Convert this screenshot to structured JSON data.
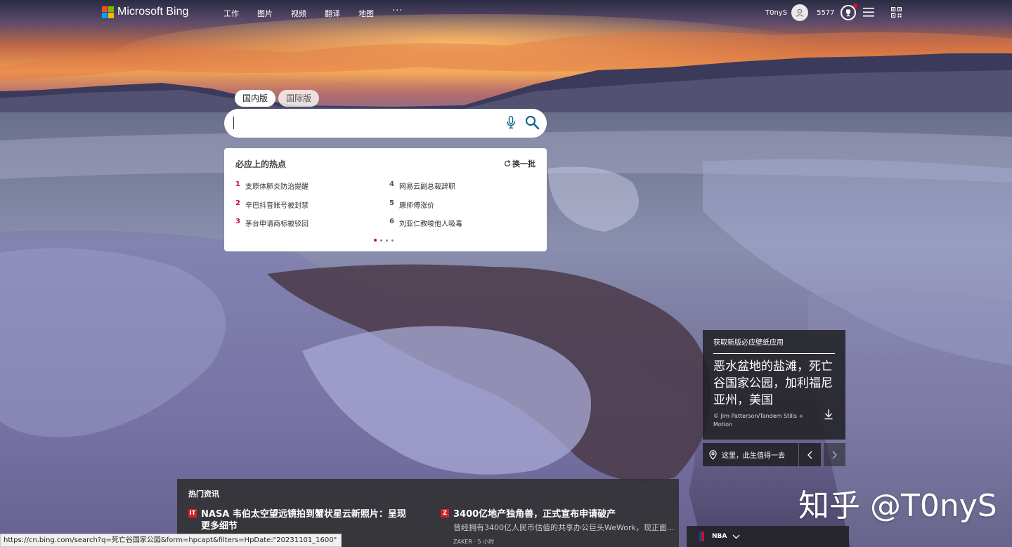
{
  "header": {
    "brand": "Microsoft Bing",
    "nav": [
      "工作",
      "图片",
      "视频",
      "翻译",
      "地图"
    ],
    "more": "···",
    "user_name": "T0nyS",
    "points": "5577"
  },
  "search": {
    "tabs": [
      {
        "label": "国内版",
        "active": true
      },
      {
        "label": "国际版",
        "active": false
      }
    ],
    "value": ""
  },
  "hot": {
    "title": "必应上的热点",
    "refresh_label": "换一批",
    "items": [
      {
        "rank": "1",
        "text": "支原体肺炎防治提醒"
      },
      {
        "rank": "2",
        "text": "辛巴抖音账号被封禁"
      },
      {
        "rank": "3",
        "text": "茅台申请商标被驳回"
      },
      {
        "rank": "4",
        "text": "网易云副总裁辞职"
      },
      {
        "rank": "5",
        "text": "康师傅涨价"
      },
      {
        "rank": "6",
        "text": "刘亚仁教唆他人吸毒"
      }
    ],
    "page_count": 4,
    "active_page": 1
  },
  "image_info": {
    "promo": "获取新版必应壁纸应用",
    "title": "恶水盆地的盐滩，死亡谷国家公园，加利福尼亚州，美国",
    "credit": "© Jim Patterson/Tandem Stills + Motion",
    "place_label": "这里，此生值得一去"
  },
  "news": {
    "heading": "热门资讯",
    "items": [
      {
        "badge": "IT",
        "title": "NASA 韦伯太空望远镜拍到蟹状星云新照片：呈现更多细节",
        "snippet": "",
        "meta": ""
      },
      {
        "badge": "Z",
        "title": "3400亿地产独角兽，正式宣布申请破产",
        "snippet": "曾经拥有3400亿人民币估值的共享办公巨头WeWork，现正面...",
        "meta": "ZAKER · 5 小时"
      }
    ]
  },
  "sports": {
    "label": "NBA"
  },
  "watermark": "知乎 @T0nyS",
  "status_url": "https://cn.bing.com/search?q=死亡谷国家公园&form=hpcapt&filters=HpDate:\"20231101_1600\"",
  "colors": {
    "ms_red": "#f25022",
    "ms_green": "#7fba00",
    "ms_blue": "#00a4ef",
    "ms_yellow": "#ffb900",
    "hot_rank": "#c8102e",
    "search_icon": "#0f6b8c"
  }
}
